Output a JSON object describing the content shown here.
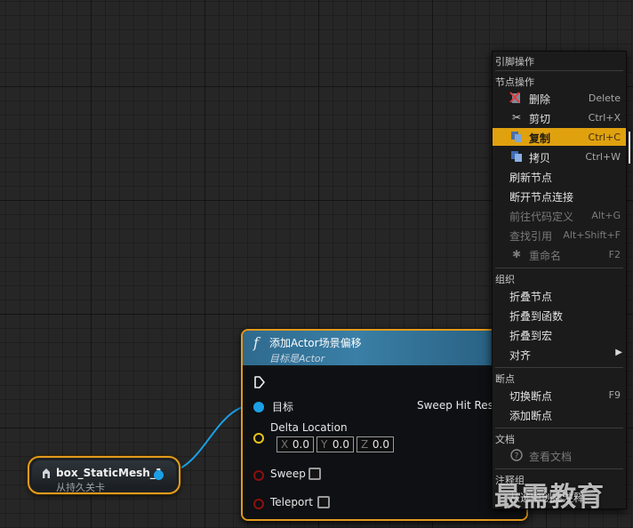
{
  "variable_node": {
    "name": "box_StaticMesh_1",
    "subtitle": "从持久关卡",
    "icon": "variable-get-icon"
  },
  "function_node": {
    "icon_glyph": "f",
    "title": "添加Actor场景偏移",
    "target_label": "目标是Actor",
    "pins": {
      "target": "目标",
      "delta_location": "Delta Location",
      "sweep": "Sweep",
      "teleport": "Teleport",
      "sweep_hit_result": "Sweep Hit Resu"
    },
    "vector": {
      "x_label": "X",
      "x_value": "0.0",
      "y_label": "Y",
      "y_value": "0.0",
      "z_label": "Z",
      "z_value": "0.0"
    },
    "sweep_checked": false,
    "teleport_checked": false
  },
  "context_menu": {
    "header": "引脚操作",
    "sections": {
      "node_actions": "节点操作",
      "organize": "组织",
      "breakpoints": "断点",
      "documentation": "文档",
      "comment_group": "注释组"
    },
    "items": {
      "delete": {
        "label": "删除",
        "shortcut": "Delete"
      },
      "cut": {
        "label": "剪切",
        "shortcut": "Ctrl+X"
      },
      "copy": {
        "label": "复制",
        "shortcut": "Ctrl+C"
      },
      "duplicate": {
        "label": "拷贝",
        "shortcut": "Ctrl+W"
      },
      "refresh": {
        "label": "刷新节点"
      },
      "break_links": {
        "label": "断开节点连接"
      },
      "goto_definition": {
        "label": "前往代码定义",
        "shortcut": "Alt+G"
      },
      "find_references": {
        "label": "查找引用",
        "shortcut": "Alt+Shift+F"
      },
      "rename": {
        "label": "重命名",
        "shortcut": "F2"
      },
      "collapse_nodes": {
        "label": "折叠节点"
      },
      "collapse_function": {
        "label": "折叠到函数"
      },
      "collapse_macro": {
        "label": "折叠到宏"
      },
      "align": {
        "label": "对齐"
      },
      "toggle_breakpoint": {
        "label": "切换断点",
        "shortcut": "F9"
      },
      "add_breakpoint": {
        "label": "添加断点"
      },
      "view_docs": {
        "label": "查看文档"
      },
      "comment_partial": {
        "label": "从选中创建注释"
      }
    },
    "highlighted_item": "copy",
    "highlight_color": "#e0a10f"
  },
  "watermark": "最需教育",
  "colors": {
    "node_border": "#e39a1c",
    "object_pin": "#1ba0e6",
    "vector_pin": "#e8c21a",
    "bool_pin": "#8e0f0f",
    "func_header": "#3a7fa6"
  }
}
